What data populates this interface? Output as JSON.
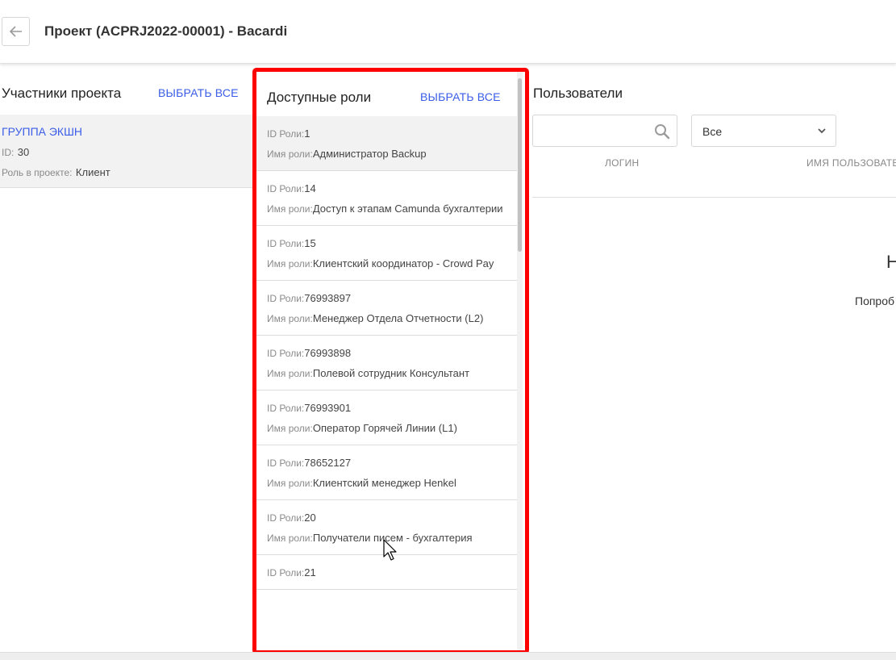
{
  "header": {
    "title": "Проект (ACPRJ2022-00001) - Bacardi"
  },
  "participants": {
    "title": "Участники проекта",
    "select_all": "ВЫБРАТЬ ВСЕ",
    "member": {
      "name": "ГРУППА ЭКШН",
      "id_label": "ID:",
      "id_value": "30",
      "role_label": "Роль в проекте:",
      "role_value": "Клиент"
    }
  },
  "roles": {
    "title": "Доступные роли",
    "select_all": "ВЫБРАТЬ ВСЕ",
    "id_label": "ID Роли:",
    "name_label": "Имя роли:",
    "items": [
      {
        "id": "1",
        "name": "Администратор Backup"
      },
      {
        "id": "14",
        "name": "Доступ к этапам Camunda бухгалтерии"
      },
      {
        "id": "15",
        "name": "Клиентский координатор - Crowd Pay"
      },
      {
        "id": "76993897",
        "name": "Менеджер Отдела Отчетности (L2)"
      },
      {
        "id": "76993898",
        "name": "Полевой сотрудник Консультант"
      },
      {
        "id": "76993901",
        "name": "Оператор Горячей Линии (L1)"
      },
      {
        "id": "78652127",
        "name": "Клиентский менеджер Henkel"
      },
      {
        "id": "20",
        "name": "Получатели писем - бухгалтерия"
      },
      {
        "id": "21",
        "name": ""
      }
    ]
  },
  "users": {
    "title": "Пользователи",
    "search_value": "",
    "filter_value": "Все",
    "columns": [
      "ЛОГИН",
      "ИМЯ ПОЛЬЗОВАТЕ"
    ],
    "empty_title": "Н",
    "empty_hint": "Попроб"
  },
  "colors": {
    "accent": "#3b5de7",
    "highlight": "#ff0000",
    "selected_bg": "#f2f2f2"
  },
  "icons": [
    "arrow-left-icon",
    "search-icon",
    "chevron-down-icon",
    "mouse-cursor-icon"
  ]
}
